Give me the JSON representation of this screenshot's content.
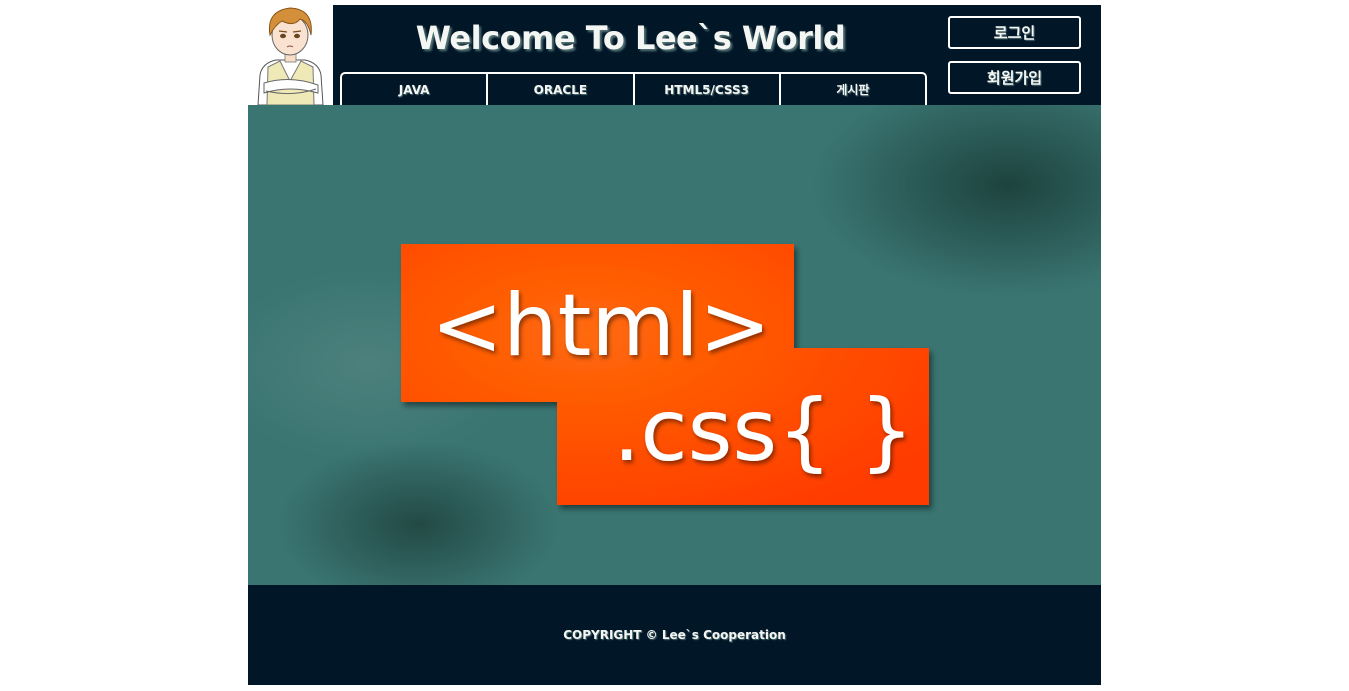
{
  "header": {
    "title": "Welcome To Lee`s World"
  },
  "nav": {
    "items": [
      "JAVA",
      "ORACLE",
      "HTML5/CSS3",
      "게시판"
    ]
  },
  "auth": {
    "login_label": "로그인",
    "signup_label": "회원가입"
  },
  "hero": {
    "line1": "<html>",
    "line2": ".css{ }",
    "accent_color": "#ff5a08"
  },
  "footer": {
    "copyright": "COPYRIGHT © Lee`s Cooperation"
  },
  "colors": {
    "header_bg": "#011627",
    "hero_bg": "#3a7572"
  },
  "avatar": {
    "icon": "boy-character-illustration"
  }
}
